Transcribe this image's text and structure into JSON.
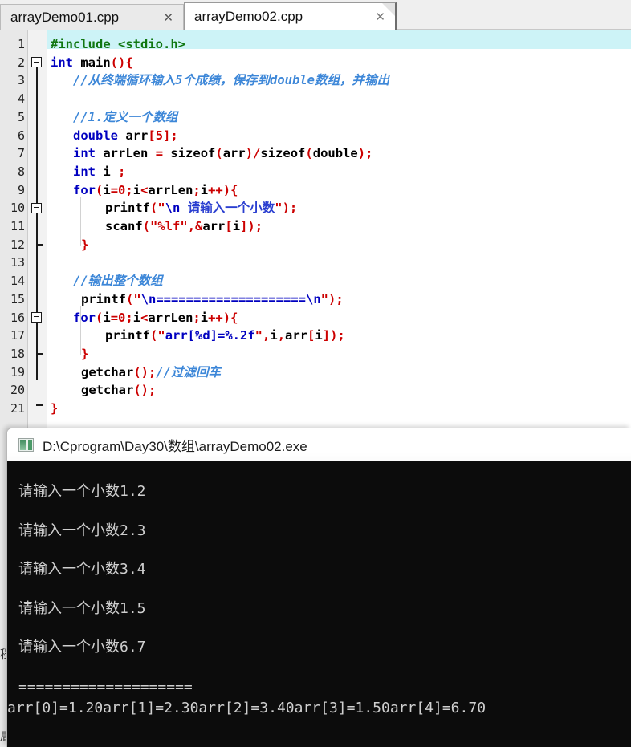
{
  "window": {
    "title": "arrayDemo02.cpp"
  },
  "tabs": [
    {
      "label": "arrayDemo01.cpp",
      "close": "✕",
      "active": false
    },
    {
      "label": "arrayDemo02.cpp",
      "close": "✕",
      "active": true
    }
  ],
  "editor": {
    "highlighted_line": 14,
    "line_numbers": [
      "1",
      "2",
      "3",
      "4",
      "5",
      "6",
      "7",
      "8",
      "9",
      "10",
      "11",
      "12",
      "13",
      "14",
      "15",
      "16",
      "17",
      "18",
      "19",
      "20",
      "21"
    ],
    "fold_markers": [
      2,
      9,
      16
    ],
    "lines": [
      {
        "n": 1,
        "text": "#include <stdio.h>"
      },
      {
        "n": 2,
        "text": "int main(){"
      },
      {
        "n": 3,
        "text": "    //从终端循环输入5个成绩，保存到double数组，并输出"
      },
      {
        "n": 4,
        "text": ""
      },
      {
        "n": 5,
        "text": "    //1.定义一个数组"
      },
      {
        "n": 6,
        "text": "    double arr[5];"
      },
      {
        "n": 7,
        "text": "    int arrLen = sizeof(arr)/sizeof(double);"
      },
      {
        "n": 8,
        "text": "    int i ;"
      },
      {
        "n": 9,
        "text": "    for(i=0;i<arrLen;i++){"
      },
      {
        "n": 10,
        "text": "        printf(\"\\n 请输入一个小数\");"
      },
      {
        "n": 11,
        "text": "        scanf(\"%lf\",&arr[i]);"
      },
      {
        "n": 12,
        "text": "    }"
      },
      {
        "n": 13,
        "text": ""
      },
      {
        "n": 14,
        "text": "    //输出整个数组"
      },
      {
        "n": 15,
        "text": "    printf(\"\\n====================\\n\");"
      },
      {
        "n": 16,
        "text": "    for(i=0;i<arrLen;i++){"
      },
      {
        "n": 17,
        "text": "        printf(\"arr[%d]=%.2f\",i,arr[i]);"
      },
      {
        "n": 18,
        "text": "    }"
      },
      {
        "n": 19,
        "text": "    getchar();//过滤回车"
      },
      {
        "n": 20,
        "text": "    getchar();"
      },
      {
        "n": 21,
        "text": "}"
      }
    ]
  },
  "console": {
    "icon": "terminal-icon",
    "title": "D:\\Cprogram\\Day30数组\\arrayDemo02.exe",
    "title_raw": "D:\\Cprogram\\Day30\\数组\\arrayDemo02.exe",
    "prompts": [
      "请输入一个小数1.2",
      "请输入一个小数2.3",
      "请输入一个小数3.4",
      "请输入一个小数1.5",
      "请输入一个小数6.7"
    ],
    "separator": "====================",
    "result": "arr[0]=1.20arr[1]=2.30arr[2]=3.40arr[3]=1.50arr[4]=6.70",
    "input_values": [
      1.2,
      2.3,
      3.4,
      1.5,
      6.7
    ],
    "output_values": [
      "1.20",
      "2.30",
      "3.40",
      "1.50",
      "6.70"
    ]
  },
  "strip": {
    "glyphs": [
      "程",
      "局"
    ]
  },
  "colors": {
    "keyword": "#0000c0",
    "preprocessor": "#117711",
    "string": "#cc0000",
    "comment": "#3d87d8",
    "highlight_line": "#cdf3f7",
    "console_bg": "#0c0c0c",
    "console_fg": "#cfcfcf",
    "gutter_bg": "#e8e8e8",
    "tab_active_bg": "#ffffff",
    "tab_inactive_bg": "#eaeaea"
  }
}
